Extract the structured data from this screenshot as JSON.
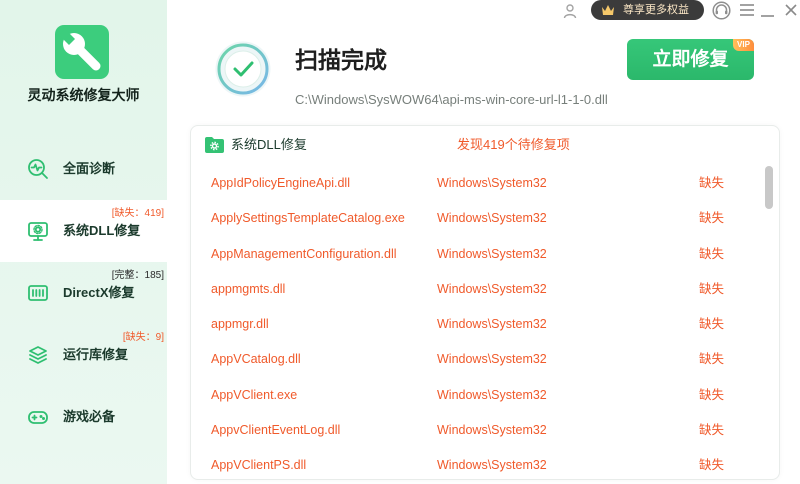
{
  "app": {
    "name": "灵动系统修复大师",
    "logo_icon": "wrench-icon"
  },
  "topbar": {
    "vip_label": "尊享更多权益",
    "icons": [
      "user-icon",
      "crown-icon",
      "service-icon",
      "menu-icon",
      "minimize-icon",
      "close-icon"
    ]
  },
  "sidebar": {
    "items": [
      {
        "label": "全面诊断",
        "icon": "diagnose-icon",
        "active": false
      },
      {
        "label": "系统DLL修复",
        "badge": "[缺失：419]",
        "icon": "monitor-gear-icon",
        "active": true
      },
      {
        "label": "DirectX修复",
        "badge": "[完整：185]",
        "icon": "directx-icon",
        "active": false
      },
      {
        "label": "运行库修复",
        "badge": "[缺失：9]",
        "icon": "layers-icon",
        "active": false
      },
      {
        "label": "游戏必备",
        "icon": "gamepad-icon",
        "active": false
      }
    ]
  },
  "scan": {
    "title": "扫描完成",
    "current_file": "C:\\Windows\\SysWOW64\\api-ms-win-core-url-l1-1-0.dll",
    "status_icon": "check-circle-icon"
  },
  "repair_button": {
    "label": "立即修复",
    "badge": "VIP"
  },
  "panel": {
    "title": "系统DLL修复",
    "icon": "folder-gear-icon",
    "summary": "发现419个待修复项",
    "rows": [
      {
        "name": "AppIdPolicyEngineApi.dll",
        "path": "Windows\\System32",
        "status": "缺失"
      },
      {
        "name": "ApplySettingsTemplateCatalog.exe",
        "path": "Windows\\System32",
        "status": "缺失"
      },
      {
        "name": "AppManagementConfiguration.dll",
        "path": "Windows\\System32",
        "status": "缺失"
      },
      {
        "name": "appmgmts.dll",
        "path": "Windows\\System32",
        "status": "缺失"
      },
      {
        "name": "appmgr.dll",
        "path": "Windows\\System32",
        "status": "缺失"
      },
      {
        "name": "AppVCatalog.dll",
        "path": "Windows\\System32",
        "status": "缺失"
      },
      {
        "name": "AppVClient.exe",
        "path": "Windows\\System32",
        "status": "缺失"
      },
      {
        "name": "AppvClientEventLog.dll",
        "path": "Windows\\System32",
        "status": "缺失"
      },
      {
        "name": "AppVClientPS.dll",
        "path": "Windows\\System32",
        "status": "缺失"
      }
    ]
  },
  "colors": {
    "accent": "#2fbf71",
    "missing": "#f05a2b",
    "sidebar_bg": "#e6f6ed",
    "vip_pill": "#3b3b3b"
  }
}
